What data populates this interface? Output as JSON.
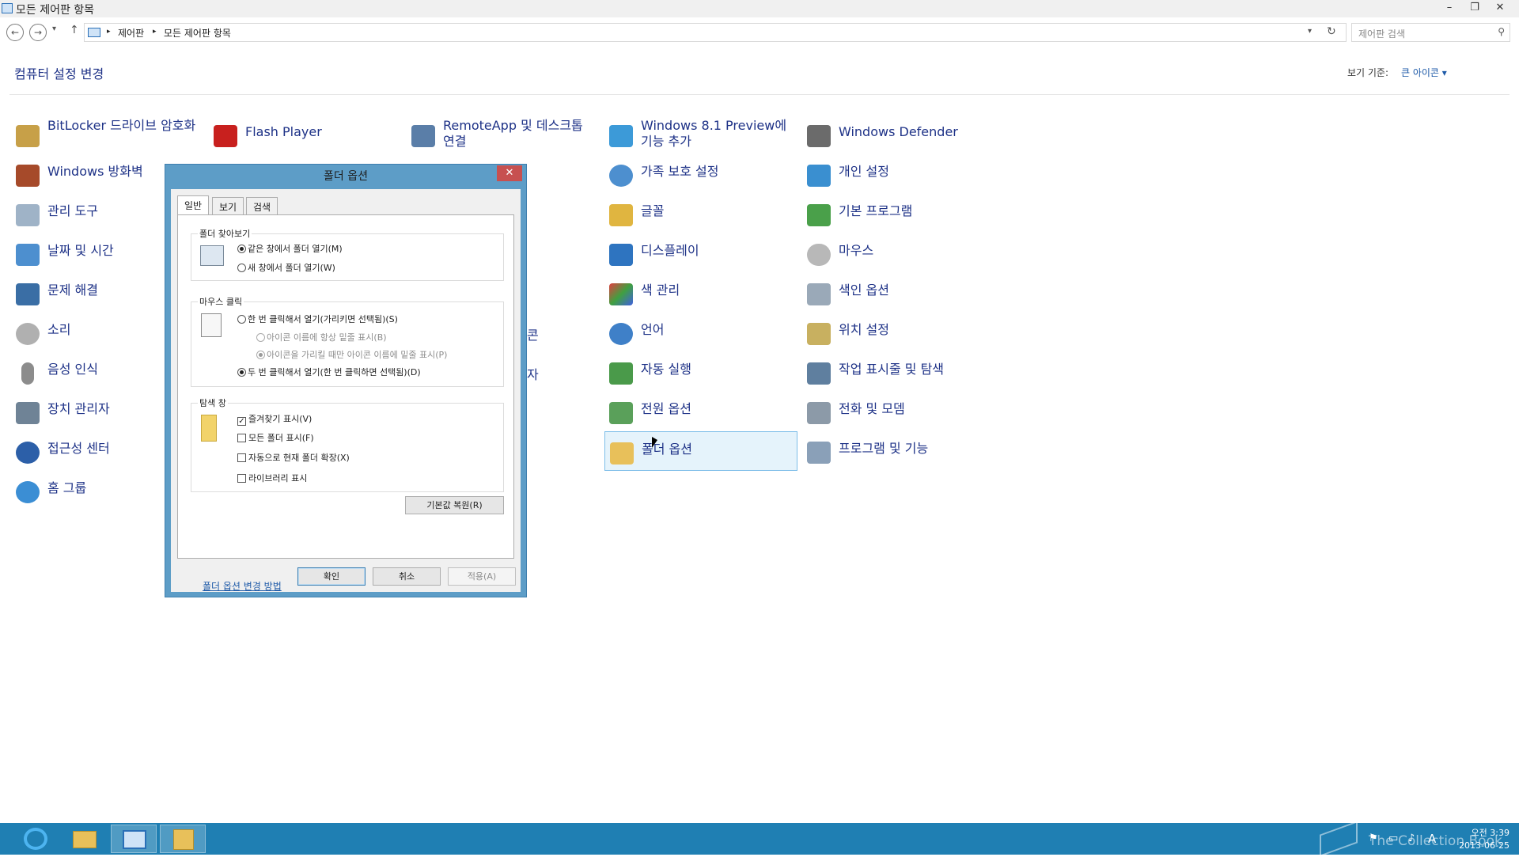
{
  "window": {
    "title": "모든 제어판 항목",
    "minimize": "–",
    "restore": "❐",
    "close": "✕"
  },
  "address": {
    "crumbs": [
      "제어판",
      "모든 제어판 항목"
    ],
    "search_placeholder": "제어판 검색"
  },
  "header": {
    "title": "컴퓨터 설정 변경",
    "view_by_label": "보기 기준:",
    "view_by_value": "큰 아이콘 ▾"
  },
  "items": {
    "bitlocker": "BitLocker 드라이브 암호화",
    "windows_firewall": "Windows 방화벽",
    "admin_tools": "관리 도구",
    "date_time": "날짜 및 시간",
    "troubleshooting": "문제 해결",
    "sound": "소리",
    "speech_recognition": "음성 인식",
    "device_manager": "장치 관리자",
    "ease_of_access": "접근성 센터",
    "homegroup": "홈 그룹",
    "flash_player": "Flash Player",
    "remoteapp": "RemoteApp 및 데스크톱 연결",
    "partial_icon": "콘",
    "partial_manager": "자",
    "windows81": "Windows 8.1 Preview에 기능 추가",
    "family_safety": "가족 보호 설정",
    "fonts": "글꼴",
    "display": "디스플레이",
    "color_management": "색 관리",
    "language": "언어",
    "autoplay": "자동 실행",
    "power_options": "전원 옵션",
    "folder_options": "폴더 옵션",
    "windows_defender": "Windows Defender",
    "personalization": "개인 설정",
    "default_programs": "기본 프로그램",
    "mouse": "마우스",
    "indexing_options": "색인 옵션",
    "location_settings": "위치 설정",
    "taskbar_navigation": "작업 표시줄 및 탐색",
    "phone_modem": "전화 및 모뎀",
    "programs_features": "프로그램 및 기능"
  },
  "dialog": {
    "title": "폴더 옵션",
    "close": "✕",
    "tabs": [
      "일반",
      "보기",
      "검색"
    ],
    "browse_group": {
      "title": "폴더 찾아보기",
      "options": [
        "같은 창에서 폴더 열기(M)",
        "새 창에서 폴더 열기(W)"
      ]
    },
    "click_group": {
      "title": "마우스 클릭",
      "single": "한 번 클릭해서 열기(가리키면 선택됨)(S)",
      "underline_always": "아이콘 이름에 항상 밑줄 표시(B)",
      "underline_point": "아이콘을 가리킬 때만 아이콘 이름에 밑줄 표시(P)",
      "double": "두 번 클릭해서 열기(한 번 클릭하면 선택됨)(D)"
    },
    "nav_group": {
      "title": "탐색 창",
      "options": [
        "즐겨찾기 표시(V)",
        "모든 폴더 표시(F)",
        "자동으로 현재 폴더 확장(X)",
        "라이브러리 표시"
      ]
    },
    "restore_defaults": "기본값 복원(R)",
    "help_link": "폴더 옵션 변경 방법",
    "ok": "확인",
    "cancel": "취소",
    "apply": "적용(A)"
  },
  "taskbar": {
    "time": "오전 3:39",
    "date": "2013-06-25",
    "ime": "A",
    "watermark": "The Collection Book"
  },
  "colors": {
    "link": "#1e3287",
    "taskbar": "#1f7fb3",
    "dialog_frame": "#5d9dc7",
    "selection": "#e5f3fb"
  }
}
